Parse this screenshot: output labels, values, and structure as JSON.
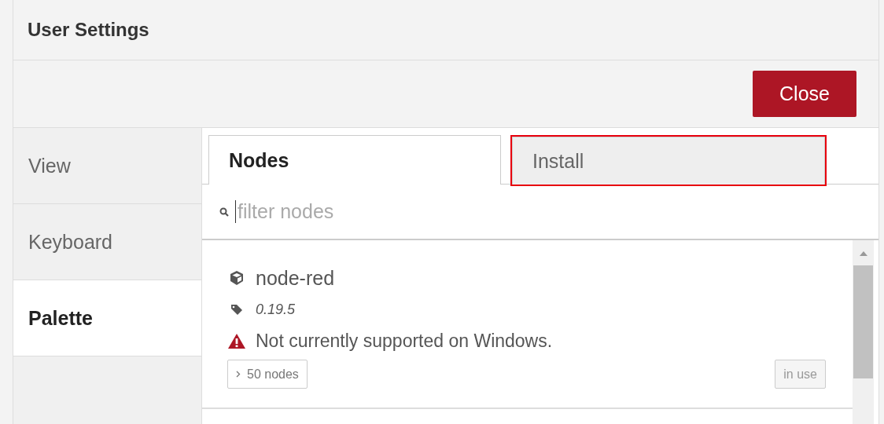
{
  "dialog": {
    "title": "User Settings",
    "close_button": "Close"
  },
  "sidebar": {
    "items": [
      {
        "label": "View",
        "selected": false
      },
      {
        "label": "Keyboard",
        "selected": false
      },
      {
        "label": "Palette",
        "selected": true
      }
    ]
  },
  "tabs": [
    {
      "label": "Nodes",
      "selected": true,
      "highlighted": false
    },
    {
      "label": "Install",
      "selected": false,
      "highlighted": true
    }
  ],
  "search": {
    "placeholder": "filter nodes"
  },
  "modules": [
    {
      "name": "node-red",
      "version": "0.19.5",
      "warning": "Not currently supported on Windows.",
      "nodes_button": "50 nodes",
      "status_button": "in use",
      "status_disabled": true
    }
  ]
}
